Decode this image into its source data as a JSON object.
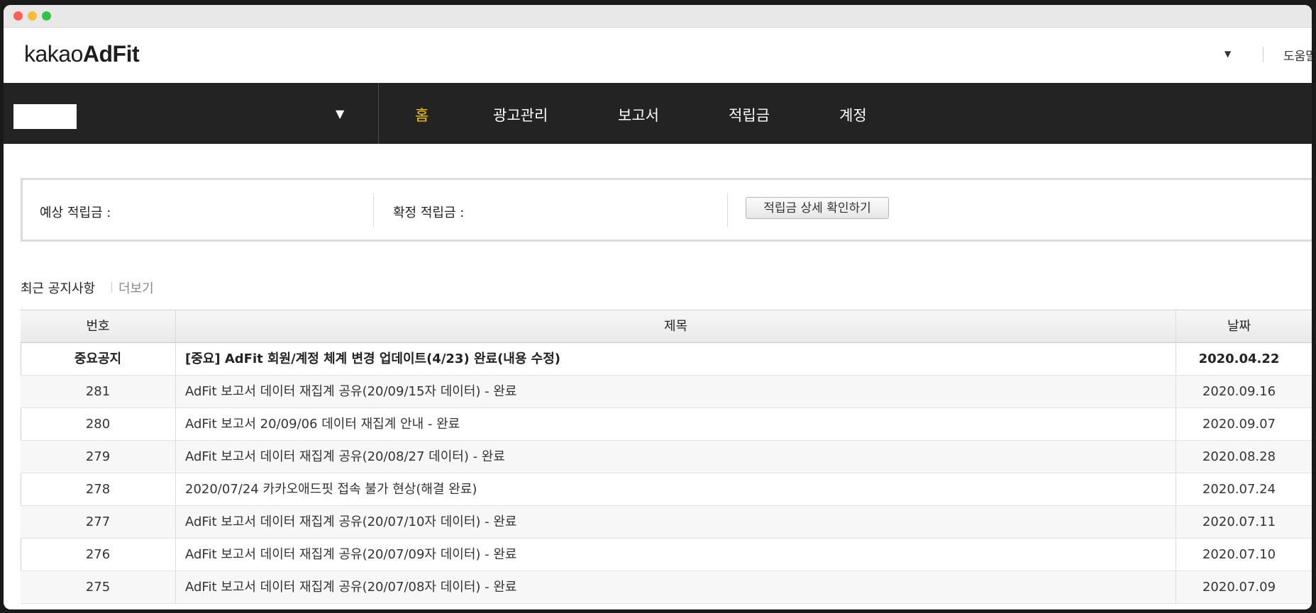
{
  "window": {
    "traffic_lights": [
      "red",
      "yellow",
      "green"
    ]
  },
  "header": {
    "logo_light": "kakao",
    "logo_bold": "AdFit",
    "user_caret": "▼",
    "help_link": "도움말"
  },
  "gnb": {
    "site_caret": "▼",
    "nav": [
      {
        "label": "홈",
        "active": true
      },
      {
        "label": "광고관리"
      },
      {
        "label": "보고서"
      },
      {
        "label": "적립금"
      },
      {
        "label": "계정"
      }
    ]
  },
  "summary": {
    "expected_label": "예상 적립금 :",
    "confirmed_label": "확정 적립금 :",
    "detail_button": "적립금 상세 확인하기"
  },
  "notices": {
    "title": "최근 공지사항",
    "more": "더보기",
    "columns": [
      "번호",
      "제목",
      "날짜"
    ],
    "rows": [
      {
        "num": "중요공지",
        "title": "[중요] AdFit 회원/계정 체계 변경 업데이트(4/23) 완료(내용 수정)",
        "date": "2020.04.22"
      },
      {
        "num": "281",
        "title": "AdFit 보고서 데이터 재집계 공유(20/09/15자 데이터) - 완료",
        "date": "2020.09.16"
      },
      {
        "num": "280",
        "title": "AdFit 보고서 20/09/06 데이터 재집계 안내 - 완료",
        "date": "2020.09.07"
      },
      {
        "num": "279",
        "title": "AdFit 보고서 데이터 재집계 공유(20/08/27 데이터) - 완료",
        "date": "2020.08.28"
      },
      {
        "num": "278",
        "title": "2020/07/24 카카오애드핏 접속 불가 현상(해결 완료)",
        "date": "2020.07.24"
      },
      {
        "num": "277",
        "title": "AdFit 보고서 데이터 재집계 공유(20/07/10자 데이터) - 완료",
        "date": "2020.07.11"
      },
      {
        "num": "276",
        "title": "AdFit 보고서 데이터 재집계 공유(20/07/09자 데이터) - 완료",
        "date": "2020.07.10"
      },
      {
        "num": "275",
        "title": "AdFit 보고서 데이터 재집계 공유(20/07/08자 데이터) - 완료",
        "date": "2020.07.09"
      }
    ]
  }
}
